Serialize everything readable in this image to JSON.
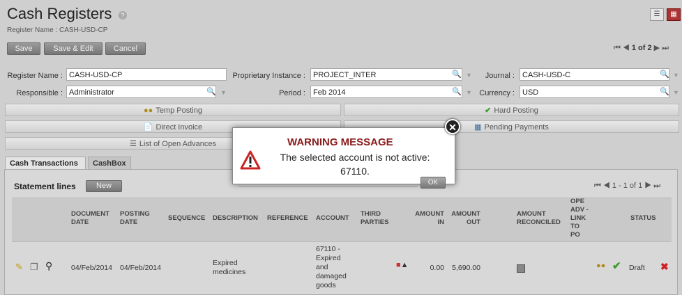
{
  "header": {
    "title": "Cash Registers",
    "subtitle": "Register Name : CASH-USD-CP",
    "help": "?"
  },
  "toolbar": {
    "save_label": "Save",
    "save_edit_label": "Save & Edit",
    "cancel_label": "Cancel",
    "pager": "1 of 2"
  },
  "form": {
    "register_name_label": "Register Name :",
    "register_name_value": "CASH-USD-CP",
    "proprietary_label": "Proprietary Instance :",
    "proprietary_value": "PROJECT_INTER",
    "journal_label": "Journal :",
    "journal_value": "CASH-USD-C",
    "responsible_label": "Responsible :",
    "responsible_value": "Administrator",
    "period_label": "Period :",
    "period_value": "Feb 2014",
    "currency_label": "Currency :",
    "currency_value": "USD"
  },
  "actions": {
    "temp_posting": "Temp Posting",
    "hard_posting": "Hard Posting",
    "direct_invoice": "Direct Invoice",
    "pending_payments": "Pending Payments",
    "open_advances": "List of Open Advances"
  },
  "tabs": [
    {
      "label": "Cash Transactions"
    },
    {
      "label": "CashBox"
    }
  ],
  "statement": {
    "title": "Statement lines",
    "new_label": "New",
    "pager": "1 - 1 of 1",
    "columns": {
      "document_date": [
        "DOCUMENT",
        "DATE"
      ],
      "posting_date": [
        "POSTING",
        "DATE"
      ],
      "sequence": "SEQUENCE",
      "description": "DESCRIPTION",
      "reference": "REFERENCE",
      "account": "ACCOUNT",
      "third_parties": [
        "THIRD",
        "PARTIES"
      ],
      "amount_in": [
        "AMOUNT",
        "IN"
      ],
      "amount_out": [
        "AMOUNT",
        "OUT"
      ],
      "amount_reconciled": [
        "AMOUNT",
        "RECONCILED"
      ],
      "ope_adv": [
        "OPE",
        "ADV -",
        "LINK",
        "TO",
        "PO"
      ],
      "status": "STATUS"
    },
    "rows": [
      {
        "document_date": "04/Feb/2014",
        "posting_date": "04/Feb/2014",
        "description": [
          "Expired",
          "medicines"
        ],
        "account": [
          "67110 -",
          "Expired",
          "and",
          "damaged",
          "goods"
        ],
        "amount_in": "0.00",
        "amount_out": "5,690.00",
        "status": "Draft"
      }
    ]
  },
  "dialog": {
    "title": "WARNING MESSAGE",
    "message_line1": "The selected account is not active:",
    "message_line2": "67110.",
    "ok_label": "OK"
  }
}
